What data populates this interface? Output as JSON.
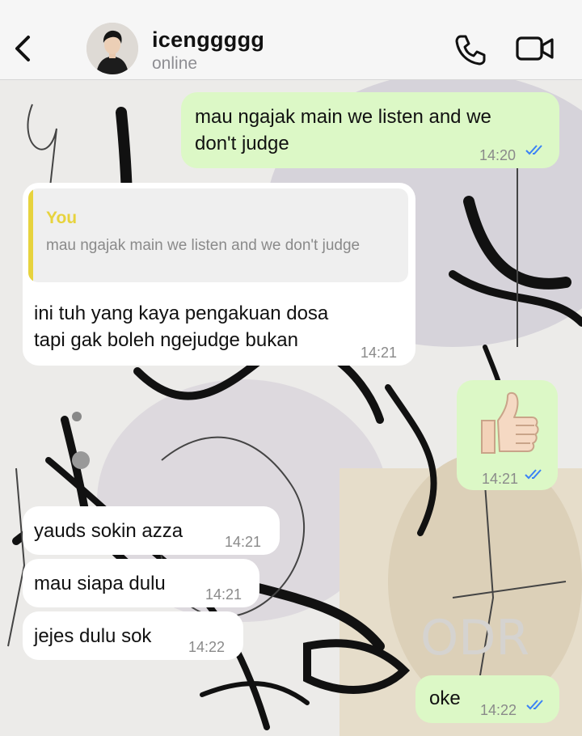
{
  "header": {
    "contact_name": "icenggggg",
    "status": "online",
    "icons": [
      "back-chevron-icon",
      "avatar",
      "phone-icon",
      "video-camera-icon"
    ]
  },
  "messages": [
    {
      "direction": "outgoing",
      "text_lines": [
        "mau ngajak main we listen and we",
        "don't judge"
      ],
      "time": "14:20",
      "read": true
    },
    {
      "direction": "incoming",
      "reply_to": {
        "author": "You",
        "text": "mau ngajak main we listen and we don't judge"
      },
      "text_lines": [
        "ini tuh yang kaya pengakuan dosa",
        "tapi gak boleh ngejudge bukan"
      ],
      "time": "14:21"
    },
    {
      "direction": "outgoing",
      "emoji": "👍🏻",
      "time": "14:21",
      "read": true
    },
    {
      "direction": "incoming",
      "text": "yauds sokin azza",
      "time": "14:21"
    },
    {
      "direction": "incoming",
      "text": "mau siapa dulu",
      "time": "14:21"
    },
    {
      "direction": "incoming",
      "text": "jejes dulu sok",
      "time": "14:22"
    },
    {
      "direction": "outgoing",
      "text": "oke",
      "time": "14:22",
      "read": true
    }
  ],
  "colors": {
    "outgoing_bubble": "#dcf8c6",
    "incoming_bubble": "#ffffff",
    "read_ticks": "#3b82f6",
    "quote_accent": "#e7d33d",
    "header_bg": "#f6f6f6"
  }
}
